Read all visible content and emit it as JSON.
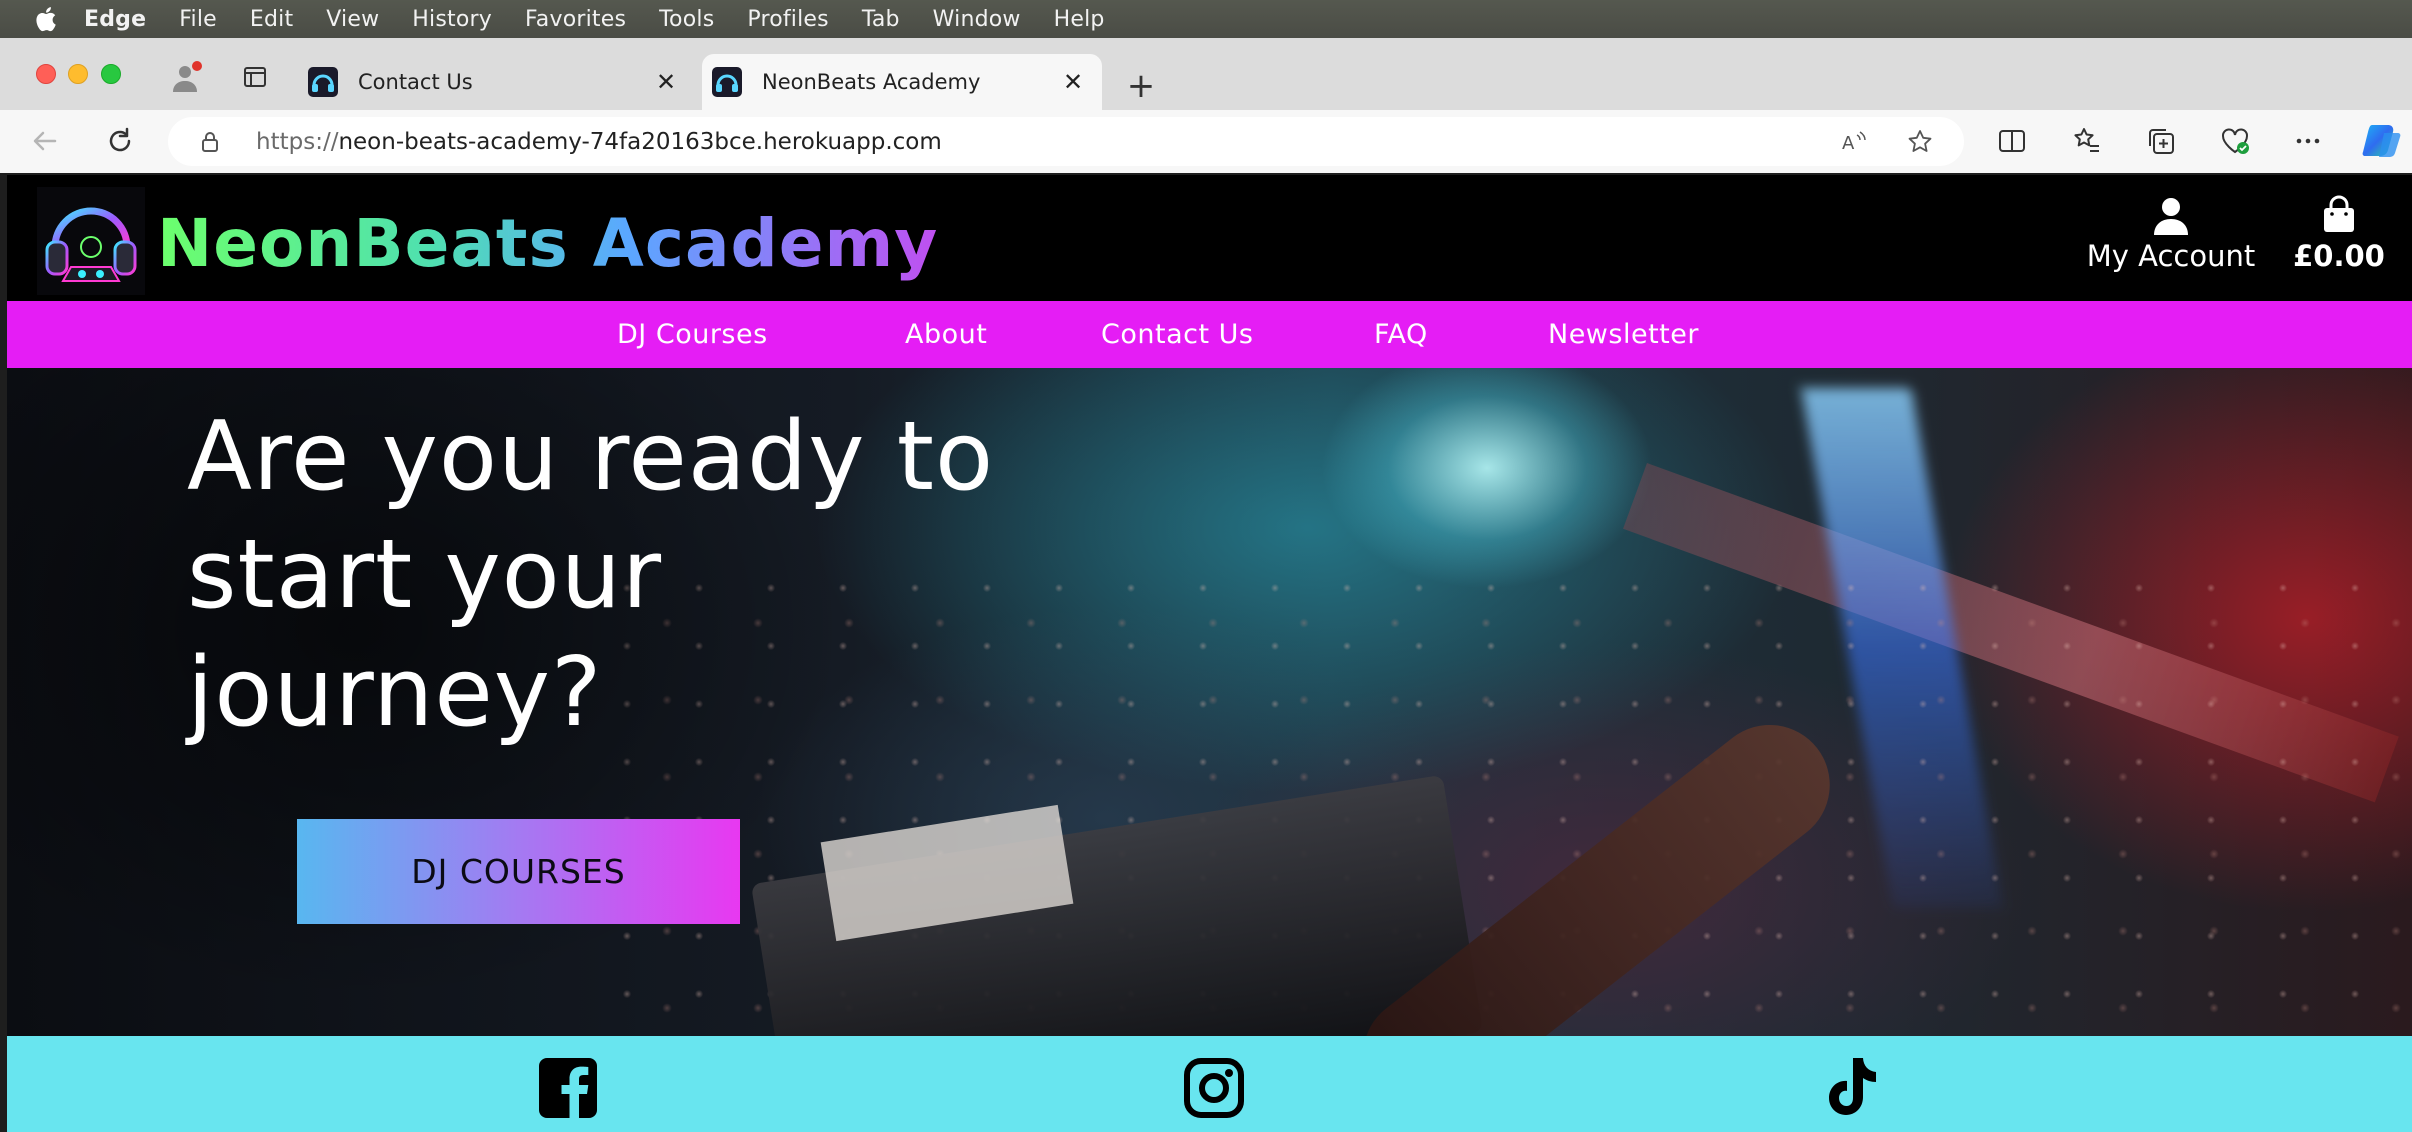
{
  "menubar": {
    "app": "Edge",
    "items": [
      "File",
      "Edit",
      "View",
      "History",
      "Favorites",
      "Tools",
      "Profiles",
      "Tab",
      "Window",
      "Help"
    ]
  },
  "browser": {
    "tabs": [
      {
        "title": "Contact Us",
        "active": false
      },
      {
        "title": "NeonBeats Academy",
        "active": true
      }
    ],
    "url_protocol": "https://",
    "url_host": "neon-beats-academy-74fa20163bce.herokuapp.com"
  },
  "site": {
    "brand": "NeonBeats Academy",
    "account_label": "My Account",
    "cart_total": "£0.00",
    "nav": [
      "DJ Courses",
      "About",
      "Contact Us",
      "FAQ",
      "Newsletter"
    ],
    "hero": {
      "headline_lines": [
        "Are you ready to",
        "start your",
        "journey?"
      ],
      "cta_label": "DJ COURSES"
    },
    "social_icons": [
      "facebook-icon",
      "instagram-icon",
      "tiktok-icon"
    ]
  },
  "colors": {
    "nav_bar": "#e51df5",
    "social_bar": "#68e5ef",
    "cta_gradient": [
      "#58b7f0",
      "#e838f1"
    ]
  }
}
